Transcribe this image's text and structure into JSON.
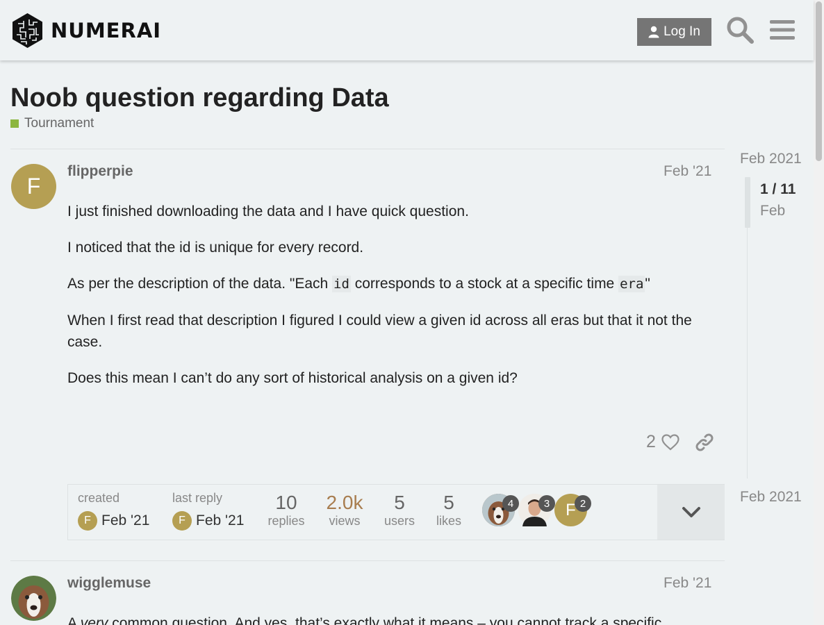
{
  "header": {
    "logo_text": "NUMERAI",
    "login_label": "Log In"
  },
  "topic": {
    "title": "Noob question regarding Data",
    "category": "Tournament",
    "category_color": "#8cb63f"
  },
  "post1": {
    "username": "flipperpie",
    "avatar_letter": "F",
    "date": "Feb '21",
    "paragraphs": [
      "I just finished downloading the data and I have quick question.",
      "I noticed that the id is unique for every record."
    ],
    "p3_before": "As per the description of the data. \"Each ",
    "p3_code1": "id",
    "p3_middle": " corresponds to a stock at a specific time ",
    "p3_code2": "era",
    "p3_after": "\"",
    "p4": "When I first read that description I figured I could view a given id across all eras but that it not the case.",
    "p5": "Does this mean I can’t do any sort of historical analysis on a given id?",
    "like_count": "2"
  },
  "topic_map": {
    "created_label": "created",
    "created_date": "Feb '21",
    "last_reply_label": "last reply",
    "last_reply_date": "Feb '21",
    "replies_num": "10",
    "replies_label": "replies",
    "views_num": "2.0k",
    "views_label": "views",
    "users_num": "5",
    "users_label": "users",
    "likes_num": "5",
    "likes_label": "likes",
    "participants": [
      {
        "count": "4"
      },
      {
        "count": "3"
      },
      {
        "letter": "F",
        "count": "2"
      }
    ]
  },
  "post2": {
    "username": "wigglemuse",
    "date": "Feb '21",
    "text_a": "A ",
    "text_em": "very",
    "text_b": " common question. And yes, that’s exactly what it means – you cannot track a specific"
  },
  "timeline": {
    "top_date": "Feb 2021",
    "position": "1 / 11",
    "current_label": "Feb",
    "bottom_date": "Feb 2021"
  }
}
